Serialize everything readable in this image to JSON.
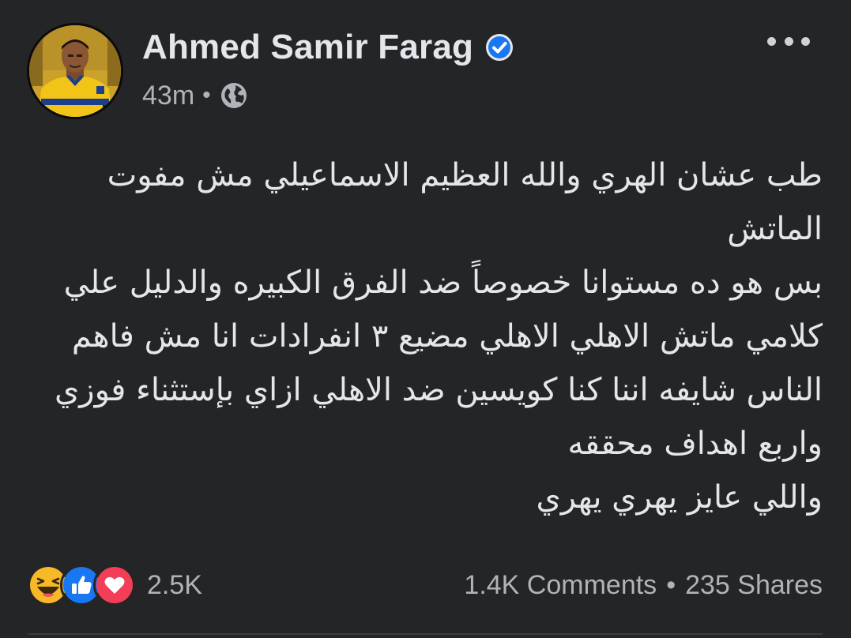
{
  "author": {
    "name": "Ahmed Samir Farag",
    "verified": true
  },
  "meta": {
    "time": "43m",
    "separator": "•",
    "audience_icon": "globe-icon"
  },
  "header": {
    "more_icon": "more-options-icon"
  },
  "post": {
    "lines": [
      "طب عشان الهري والله العظيم الاسماعيلي مش مفوت",
      "الماتش",
      "بس هو ده مستوانا خصوصاً ضد الفرق الكبيره والدليل علي",
      "كلامي ماتش الاهلي الاهلي مضيع ٣ انفرادات انا مش فاهم",
      "الناس شايفه اننا كنا كويسين ضد الاهلي ازاي بإستثناء فوزي",
      "واربع اهداف محققه",
      "واللي عايز يهري يهري"
    ]
  },
  "reactions": {
    "icons": [
      "haha-reaction-icon",
      "like-reaction-icon",
      "love-reaction-icon"
    ],
    "count": "2.5K"
  },
  "stats": {
    "comments": "1.4K Comments",
    "separator": "•",
    "shares": "235 Shares"
  },
  "colors": {
    "background": "#242526",
    "text_primary": "#e4e6eb",
    "text_secondary": "#b0b3b8",
    "verified_blue": "#1877f2",
    "like_blue": "#1877f2",
    "love_red": "#f33e58",
    "haha_yellow": "#f7b928"
  }
}
